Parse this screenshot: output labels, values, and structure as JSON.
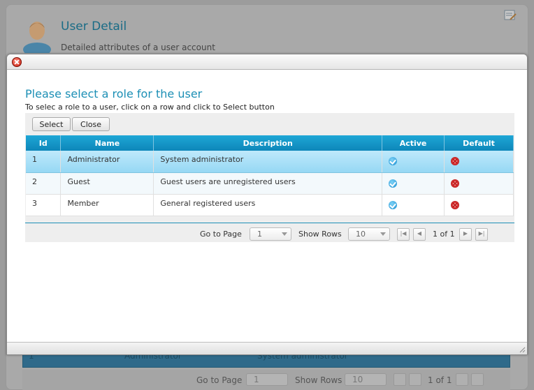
{
  "background": {
    "title": "User Detail",
    "subtitle": "Detailed attributes of a user account",
    "row": {
      "id": "1",
      "name": "Administrator",
      "description": "System administrator"
    },
    "pager": {
      "goto_label": "Go to Page",
      "page_value": "1",
      "rows_label": "Show Rows",
      "rows_value": "10",
      "page_info": "1 of 1"
    }
  },
  "dialog": {
    "heading": "Please select a role for the user",
    "instruction": "To selec a role to a user, click on a row and click to Select button",
    "toolbar": {
      "select_label": "Select",
      "close_label": "Close"
    },
    "table": {
      "headers": {
        "id": "Id",
        "name": "Name",
        "description": "Description",
        "active": "Active",
        "default": "Default"
      },
      "rows": [
        {
          "id": "1",
          "name": "Administrator",
          "description": "System administrator",
          "active": true,
          "default": false,
          "selected": true
        },
        {
          "id": "2",
          "name": "Guest",
          "description": "Guest users are unregistered users",
          "active": true,
          "default": false,
          "selected": false
        },
        {
          "id": "3",
          "name": "Member",
          "description": "General registered users",
          "active": true,
          "default": false,
          "selected": false
        }
      ]
    },
    "pager": {
      "goto_label": "Go to Page",
      "page_value": "1",
      "rows_label": "Show Rows",
      "rows_value": "10",
      "page_info": "1 of 1"
    }
  },
  "colors": {
    "accent": "#1c8fb5",
    "header": "#0d86b9",
    "selected_row": "#96d8f4"
  }
}
